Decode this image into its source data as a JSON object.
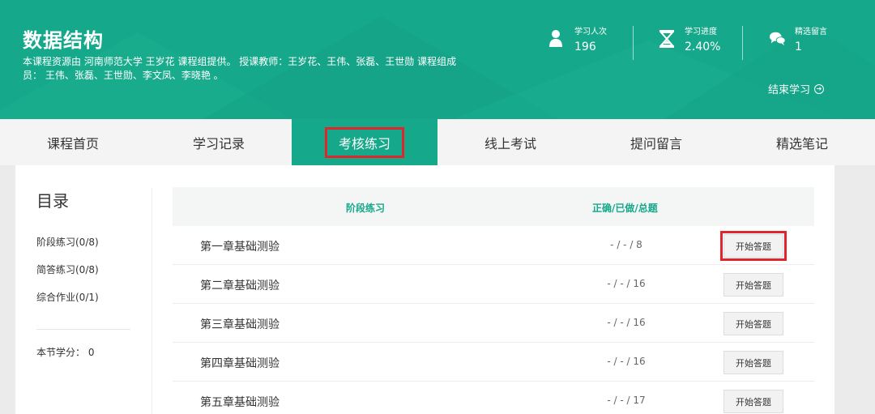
{
  "header": {
    "title": "数据结构",
    "description": "本课程资源由  河南师范大学   王岁花   课程组提供。    授课教师：王岁花、王伟、张磊、王世勋    课程组成员： 王伟、张磊、王世勋、李文凤、李晓艳 。",
    "stats": [
      {
        "icon": "person-icon",
        "label": "学习人次",
        "value": "196"
      },
      {
        "icon": "hourglass-icon",
        "label": "学习进度",
        "value": "2.40%"
      },
      {
        "icon": "chat-bubbles-icon",
        "label": "精选留言",
        "value": "1"
      }
    ],
    "end_study": "结束学习"
  },
  "tabs": [
    {
      "label": "课程首页",
      "active": false
    },
    {
      "label": "学习记录",
      "active": false
    },
    {
      "label": "考核练习",
      "active": true
    },
    {
      "label": "线上考试",
      "active": false
    },
    {
      "label": "提问留言",
      "active": false
    },
    {
      "label": "精选笔记",
      "active": false
    }
  ],
  "sidebar": {
    "title": "目录",
    "items": [
      {
        "label": "阶段练习(0/8)"
      },
      {
        "label": "简答练习(0/8)"
      },
      {
        "label": "综合作业(0/1)"
      }
    ],
    "credit": "本节学分： 0"
  },
  "table": {
    "headers": [
      "阶段练习",
      "正确/已做/总题"
    ],
    "rows": [
      {
        "name": "第一章基础测验",
        "score": "- / - / 8",
        "action": "开始答题"
      },
      {
        "name": "第二章基础测验",
        "score": "- / - / 16",
        "action": "开始答题"
      },
      {
        "name": "第三章基础测验",
        "score": "- / - / 16",
        "action": "开始答题"
      },
      {
        "name": "第四章基础测验",
        "score": "- / - / 16",
        "action": "开始答题"
      },
      {
        "name": "第五章基础测验",
        "score": "- / - / 17",
        "action": "开始答题"
      }
    ]
  },
  "colors": {
    "primary": "#16a88a",
    "highlight": "#e0262c"
  }
}
